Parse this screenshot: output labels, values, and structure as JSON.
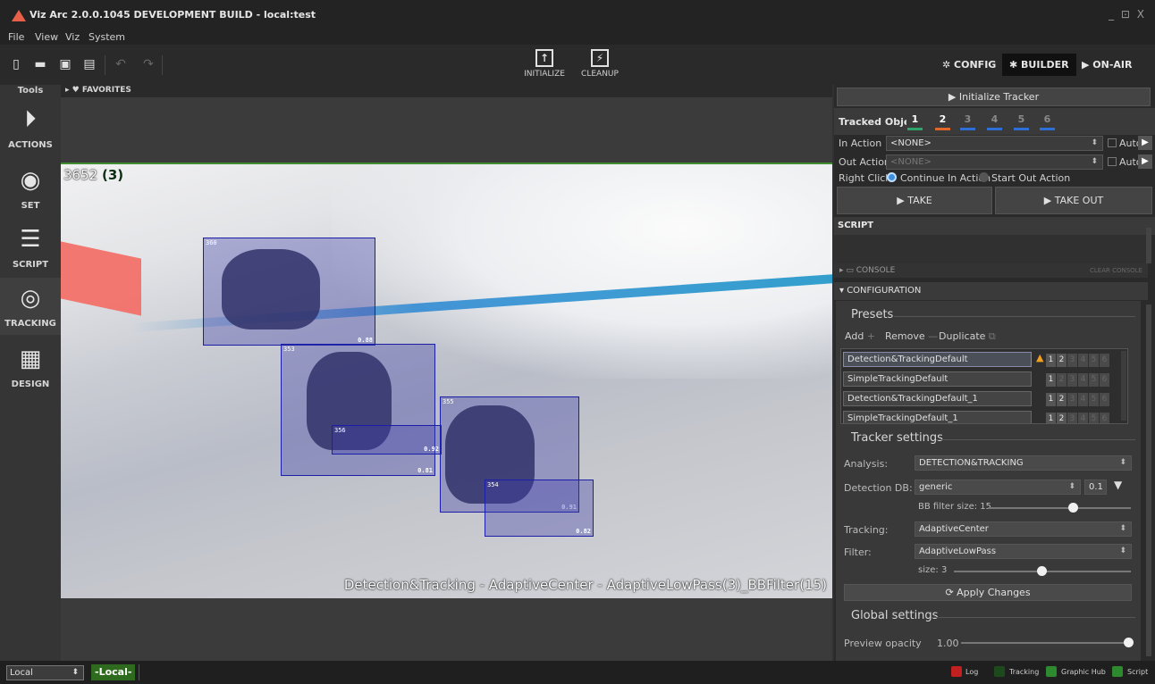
{
  "window": {
    "title": "Viz Arc 2.0.0.1045 DEVELOPMENT BUILD - local:test",
    "controls": "_ ⊡ X"
  },
  "menu": [
    "File",
    "View",
    "Viz",
    "System"
  ],
  "toolbar": {
    "initialize": "INITIALIZE",
    "cleanup": "CLEANUP",
    "config": "CONFIG",
    "builder": "BUILDER",
    "onair": "ON-AIR"
  },
  "tools": {
    "title": "Tools",
    "items": [
      {
        "label": "ACTIONS",
        "icon": "actions-icon"
      },
      {
        "label": "SET",
        "icon": "set-icon"
      },
      {
        "label": "SCRIPT",
        "icon": "script-icon"
      },
      {
        "label": "TRACKING",
        "icon": "tracking-icon"
      },
      {
        "label": "DESIGN",
        "icon": "design-icon"
      }
    ]
  },
  "favorites": "FAVORITES",
  "viewport": {
    "frame": "3652",
    "count": "(3)",
    "caption": "Detection&Tracking - AdaptiveCenter - AdaptiveLowPass(3)_BBFilter(15)",
    "boxes": [
      {
        "id": "360",
        "score": "0.88"
      },
      {
        "id": "353",
        "score": "0.81"
      },
      {
        "id": "356",
        "score": "0.92"
      },
      {
        "id": "355",
        "score": "0.91"
      },
      {
        "id": "354",
        "score": "0.82"
      }
    ]
  },
  "panel": {
    "init_tracker": "Initialize Tracker",
    "tracked_object": "Tracked Object",
    "objects": [
      {
        "n": "1",
        "color": "#2fa36a"
      },
      {
        "n": "2",
        "color": "#e0672a"
      },
      {
        "n": "3",
        "color": "#2d6fd6"
      },
      {
        "n": "4",
        "color": "#2d6fd6"
      },
      {
        "n": "5",
        "color": "#2d6fd6"
      },
      {
        "n": "6",
        "color": "#2d6fd6"
      }
    ],
    "in_action_label": "In Action",
    "in_action_value": "<NONE>",
    "out_action_label": "Out Action",
    "out_action_value": "<NONE>",
    "auto": "Auto",
    "right_click_label": "Right Click",
    "rc_opt1": "Continue In Action",
    "rc_opt2": "Start Out Action",
    "take": "TAKE",
    "take_out": "TAKE OUT",
    "script": "SCRIPT",
    "console": "CONSOLE",
    "clear_console": "CLEAR CONSOLE",
    "configuration": "CONFIGURATION",
    "presets_title": "Presets",
    "add": "Add",
    "remove": "Remove",
    "duplicate": "Duplicate",
    "presets": [
      "Detection&TrackingDefault",
      "SimpleTrackingDefault",
      "Detection&TrackingDefault_1",
      "SimpleTrackingDefault_1"
    ],
    "preset_nums": [
      "1",
      "2",
      "3",
      "4",
      "5",
      "6"
    ],
    "tracker_settings": "Tracker settings",
    "analysis_label": "Analysis:",
    "analysis_value": "DETECTION&TRACKING",
    "detection_db_label": "Detection DB:",
    "detection_db_value": "generic",
    "detection_threshold": "0.1",
    "bb_filter": "BB filter size: 15",
    "bb_filter_level": 0.6,
    "tracking_label": "Tracking:",
    "tracking_value": "AdaptiveCenter",
    "filter_label": "Filter:",
    "filter_value": "AdaptiveLowPass",
    "size_label": "size: 3",
    "size_level": 0.5,
    "apply": "Apply Changes",
    "global_settings": "Global settings",
    "preview_opacity_label": "Preview opacity",
    "preview_opacity_value": "1.00",
    "preview_opacity_level": 1.0
  },
  "status": {
    "local_select": "Local",
    "local_badge": "-Local-",
    "log": "Log",
    "tracking": "Tracking",
    "graphic_hub": "Graphic Hub",
    "script": "Script"
  }
}
